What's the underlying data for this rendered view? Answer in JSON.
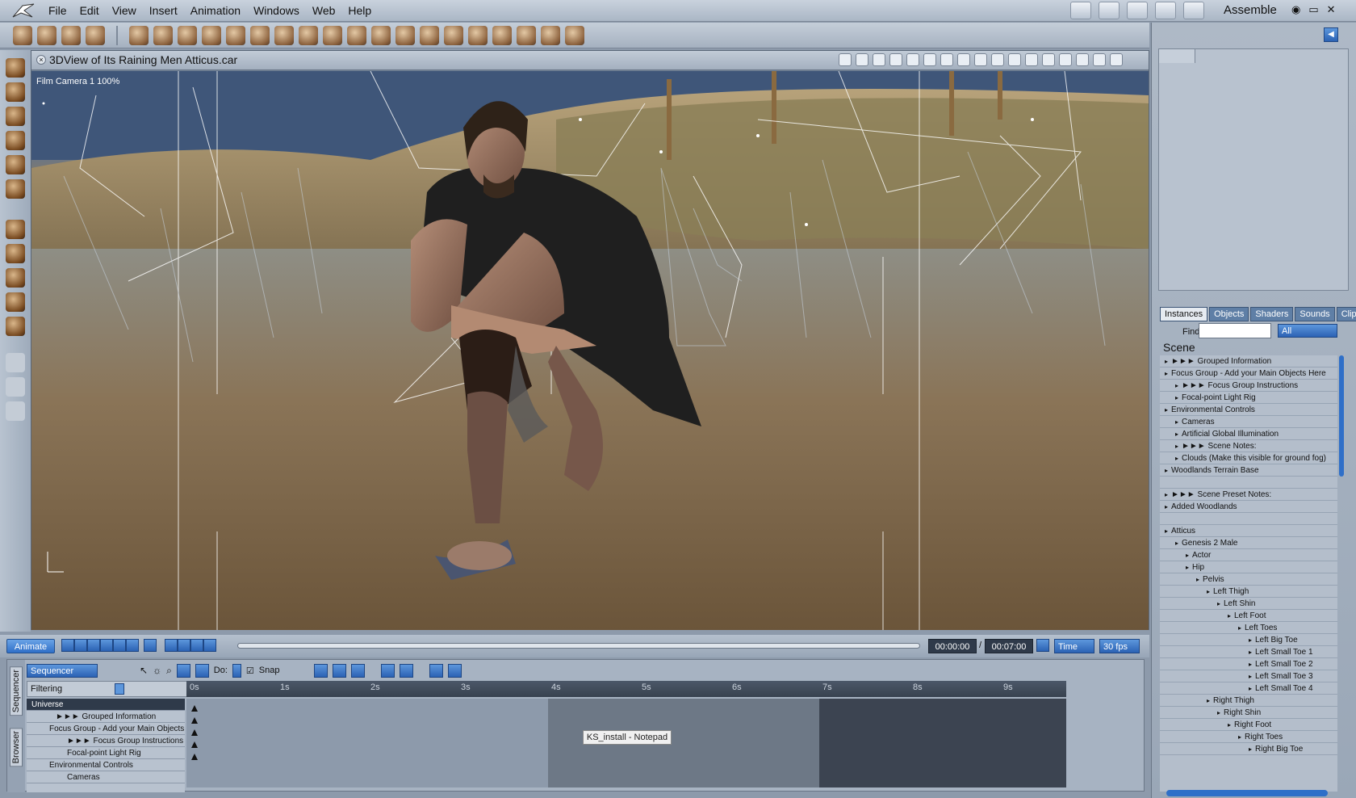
{
  "menubar": {
    "items": [
      "File",
      "Edit",
      "View",
      "Insert",
      "Animation",
      "Windows",
      "Web",
      "Help"
    ],
    "mode_label": "Assemble"
  },
  "viewport": {
    "title": "3DView of Its Raining Men Atticus.car",
    "camera_label": "Film Camera 1 100%"
  },
  "animation": {
    "animate_button": "Animate",
    "current_time": "00:00:00",
    "separator": "/",
    "total_time": "00:07:00",
    "time_mode": "Time",
    "fps": "30 fps"
  },
  "sequencer": {
    "tabs": [
      "Sequencer",
      "Browser"
    ],
    "dropdown": "Sequencer",
    "do_label": "Do:",
    "snap_label": "Snap",
    "filtering_label": "Filtering",
    "ruler_ticks": [
      "0s",
      "1s",
      "2s",
      "3s",
      "4s",
      "5s",
      "6s",
      "7s",
      "8s",
      "9s"
    ],
    "tracks": [
      {
        "label": "Universe",
        "header": true
      },
      {
        "label": "►►► Grouped Information"
      },
      {
        "label": "Focus Group - Add your Main Objects"
      },
      {
        "label": "►►► Focus Group Instructions"
      },
      {
        "label": "Focal-point Light Rig"
      },
      {
        "label": "Environmental Controls"
      },
      {
        "label": "Cameras"
      }
    ]
  },
  "taskbar_tooltip": "KS_install - Notepad",
  "right_panel": {
    "tabs": [
      "Instances",
      "Objects",
      "Shaders",
      "Sounds",
      "Clips"
    ],
    "find_label": "Find:",
    "filter_value": "All",
    "scene_label": "Scene",
    "tree": [
      {
        "label": "►►► Grouped Information",
        "depth": 0
      },
      {
        "label": "Focus Group - Add your Main Objects Here",
        "depth": 0
      },
      {
        "label": "►►► Focus Group Instructions",
        "depth": 1
      },
      {
        "label": "Focal-point Light Rig",
        "depth": 1
      },
      {
        "label": "Environmental Controls",
        "depth": 0
      },
      {
        "label": "Cameras",
        "depth": 1
      },
      {
        "label": "Artificial Global Illumination",
        "depth": 1
      },
      {
        "label": "►►► Scene Notes:",
        "depth": 1
      },
      {
        "label": "Clouds (Make this visible for ground fog)",
        "depth": 1
      },
      {
        "label": "Woodlands Terrain Base",
        "depth": 0
      },
      {
        "label": "",
        "depth": 0
      },
      {
        "label": "►►► Scene Preset Notes:",
        "depth": 0
      },
      {
        "label": "Added Woodlands",
        "depth": 0
      },
      {
        "label": "",
        "depth": 0
      },
      {
        "label": "Atticus",
        "depth": 0
      },
      {
        "label": "Genesis 2 Male",
        "depth": 1
      },
      {
        "label": "Actor",
        "depth": 2
      },
      {
        "label": "Hip",
        "depth": 2
      },
      {
        "label": "Pelvis",
        "depth": 3
      },
      {
        "label": "Left Thigh",
        "depth": 4
      },
      {
        "label": "Left Shin",
        "depth": 5
      },
      {
        "label": "Left Foot",
        "depth": 6
      },
      {
        "label": "Left Toes",
        "depth": 7
      },
      {
        "label": "Left Big Toe",
        "depth": 8
      },
      {
        "label": "Left Small Toe 1",
        "depth": 8
      },
      {
        "label": "Left Small Toe 2",
        "depth": 8
      },
      {
        "label": "Left Small Toe 3",
        "depth": 8
      },
      {
        "label": "Left Small Toe 4",
        "depth": 8
      },
      {
        "label": "Right Thigh",
        "depth": 4
      },
      {
        "label": "Right Shin",
        "depth": 5
      },
      {
        "label": "Right Foot",
        "depth": 6
      },
      {
        "label": "Right Toes",
        "depth": 7
      },
      {
        "label": "Right Big Toe",
        "depth": 8
      }
    ]
  },
  "colors": {
    "accent": "#2f6fc8",
    "chrome": "#a7b3c2",
    "timeline_dark": "#3c4451",
    "timeline_mid": "#6d7886",
    "timeline_light": "#8d9aab"
  }
}
